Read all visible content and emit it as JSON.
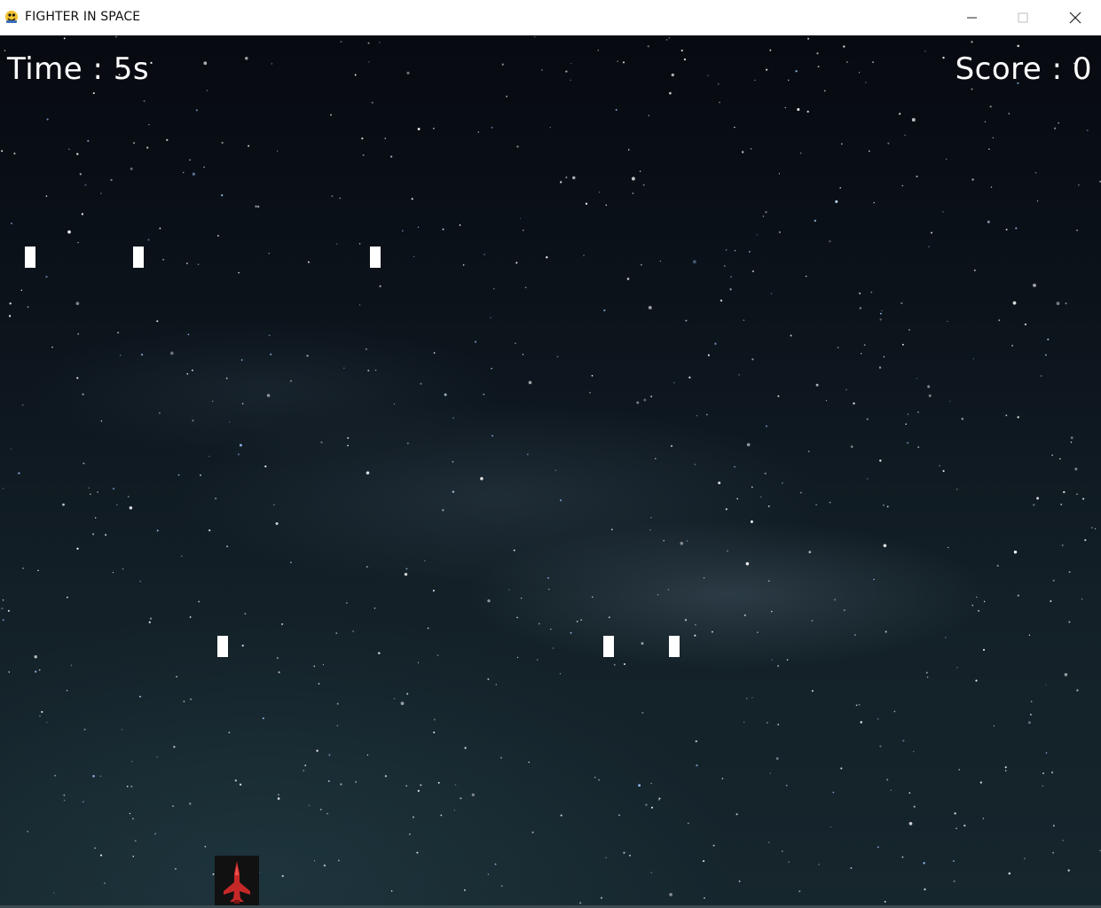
{
  "window": {
    "title": "FIGHTER IN SPACE",
    "controls": [
      "minimize-icon",
      "maximize-icon",
      "close-icon"
    ]
  },
  "hud": {
    "time": "Time : 5s",
    "score": "Score : 0"
  },
  "game": {
    "enemy_count": 6,
    "player_color": "#d32b2b",
    "bullet_color": "#ffffff"
  }
}
